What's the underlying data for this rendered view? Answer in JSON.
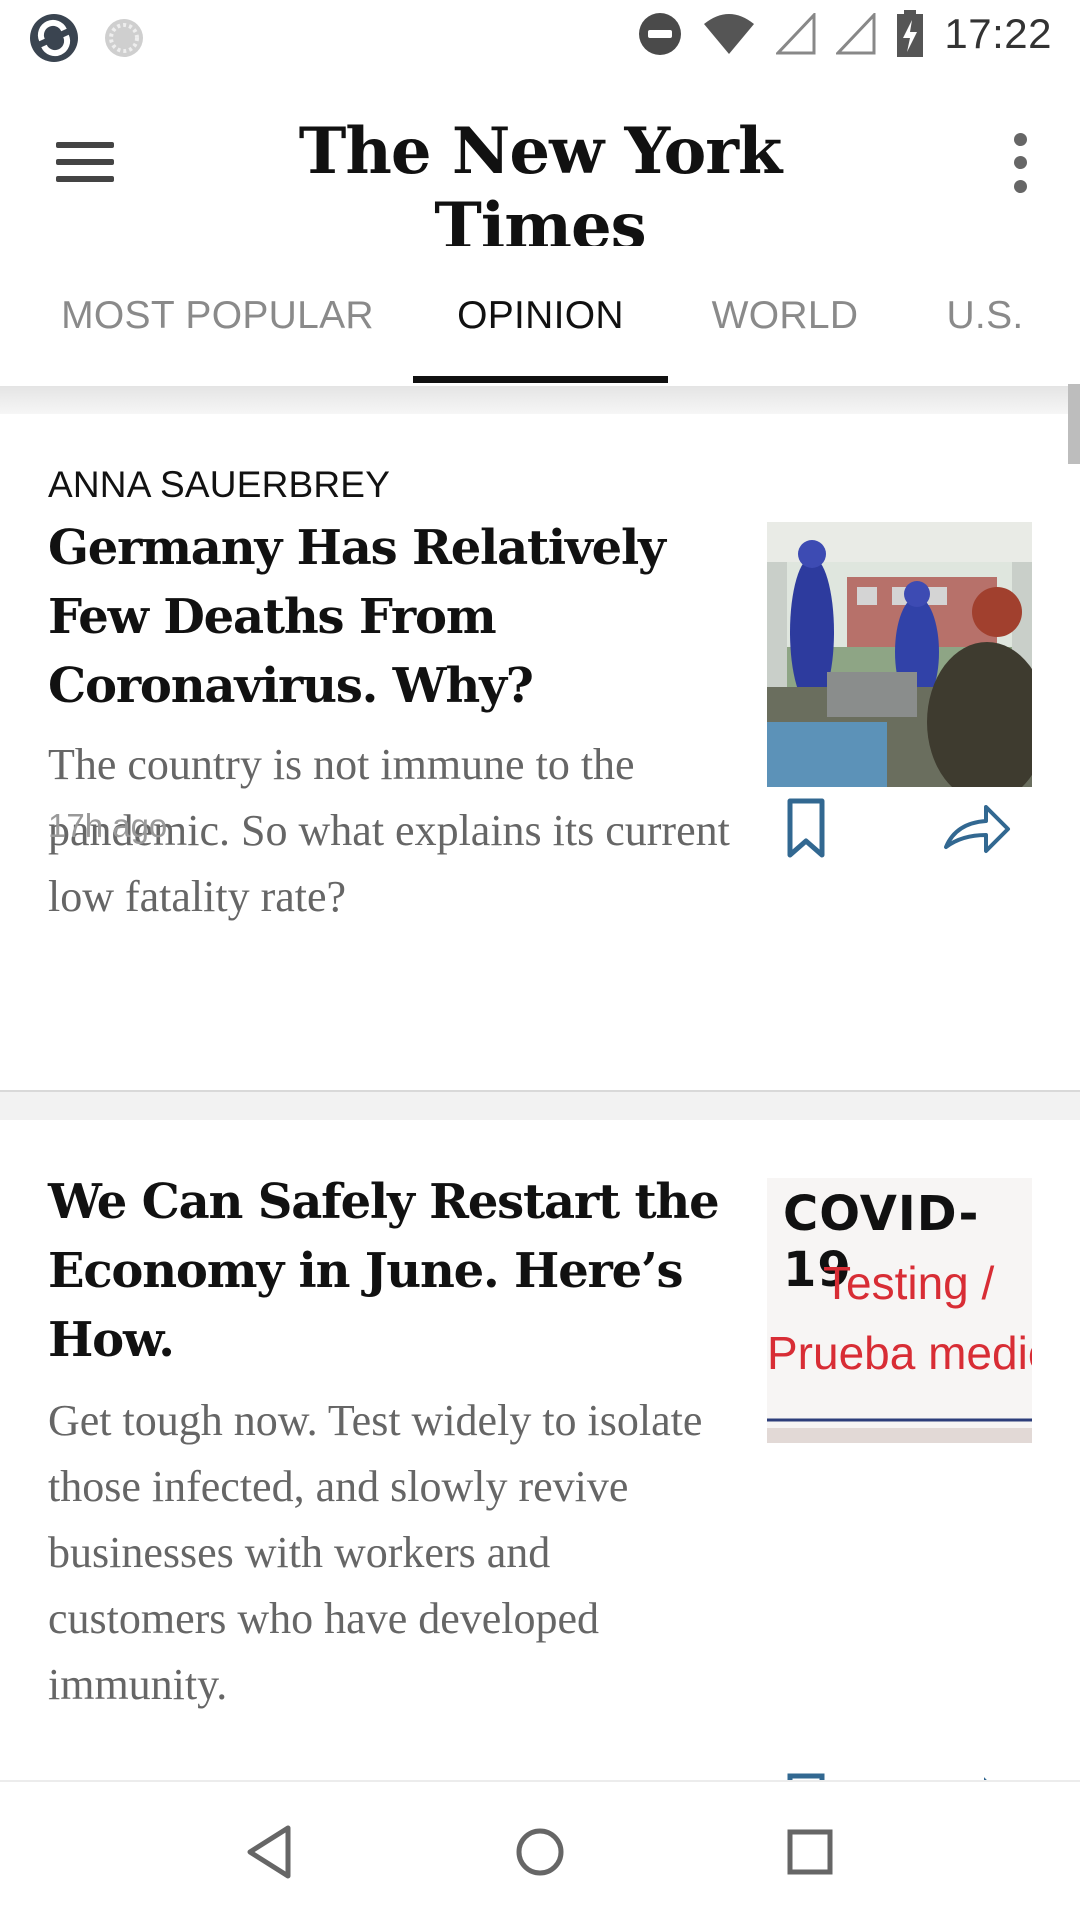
{
  "status_bar": {
    "time": "17:22",
    "icons": [
      "sync-app-icon",
      "loading-app-icon",
      "do-not-disturb-icon",
      "wifi-icon",
      "signal-icon",
      "signal-icon",
      "battery-charging-icon"
    ]
  },
  "app_bar": {
    "title": "The New York Times",
    "menu_icon": "hamburger-menu-icon",
    "more_icon": "more-vert-icon"
  },
  "tabs": [
    {
      "label": "MOST POPULAR",
      "active": false
    },
    {
      "label": "OPINION",
      "active": true
    },
    {
      "label": "WORLD",
      "active": false
    },
    {
      "label": "U.S.",
      "active": false
    }
  ],
  "articles": [
    {
      "byline": "ANNA SAUERBREY",
      "headline": "Germany Has Relatively Few Deaths From Coronavirus. Why?",
      "summary": "The country is not immune to the pandemic. So what explains its current low fatality rate?",
      "time_ago": "17h ago"
    },
    {
      "byline": "",
      "headline": "We Can Safely Restart the Economy in June. Here’s How.",
      "summary": "Get tough now. Test widely to isolate those infected, and slowly revive businesses with workers and customers who have developed immunity.",
      "image_sign_title": "COVID-19",
      "image_sign_line1": "Testing /",
      "image_sign_line2": "Prueba medica"
    }
  ],
  "nav_bar": {
    "icons": [
      "back-icon",
      "home-icon",
      "recents-icon"
    ]
  },
  "colors": {
    "text_primary": "#111111",
    "text_secondary": "#666666",
    "tab_inactive": "#8a8a8a",
    "timestamp": "#999999",
    "icon_blue": "#326891"
  }
}
